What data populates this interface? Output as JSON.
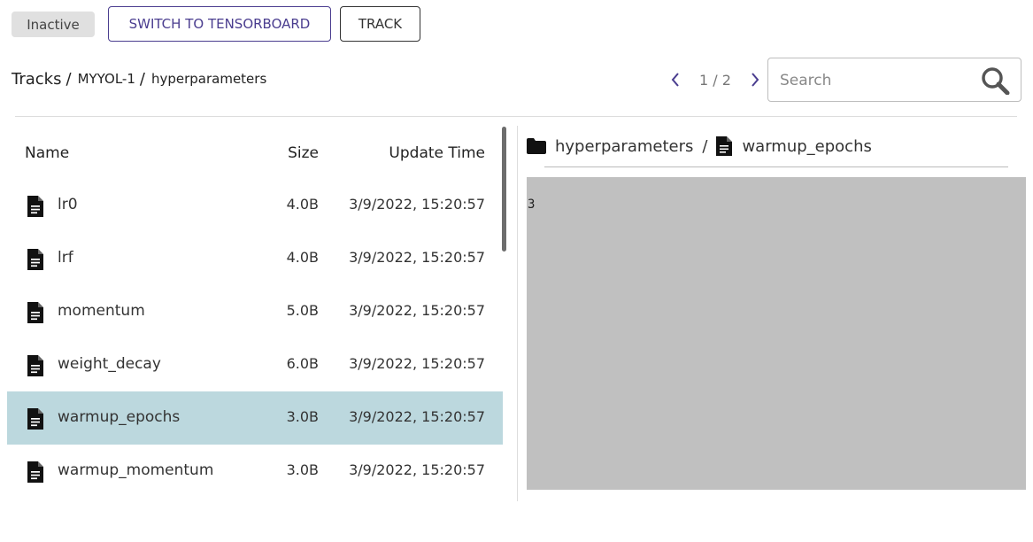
{
  "status": {
    "label": "Inactive"
  },
  "toolbar": {
    "tensorboard_label": "SWITCH TO TENSORBOARD",
    "track_label": "TRACK"
  },
  "breadcrumb": {
    "root": "Tracks",
    "separator": "/",
    "items": [
      "MYYOL-1",
      "hyperparameters"
    ]
  },
  "pagination": {
    "indicator": "1 / 2",
    "prev_icon": "chevron-left-icon",
    "next_icon": "chevron-right-icon"
  },
  "search": {
    "placeholder": "Search",
    "value": "",
    "icon": "search-icon"
  },
  "table": {
    "headers": {
      "name": "Name",
      "size": "Size",
      "update_time": "Update Time"
    },
    "rows": [
      {
        "name": "lr0",
        "size": "4.0B",
        "update_time": "3/9/2022, 15:20:57",
        "selected": false
      },
      {
        "name": "lrf",
        "size": "4.0B",
        "update_time": "3/9/2022, 15:20:57",
        "selected": false
      },
      {
        "name": "momentum",
        "size": "5.0B",
        "update_time": "3/9/2022, 15:20:57",
        "selected": false
      },
      {
        "name": "weight_decay",
        "size": "6.0B",
        "update_time": "3/9/2022, 15:20:57",
        "selected": false
      },
      {
        "name": "warmup_epochs",
        "size": "3.0B",
        "update_time": "3/9/2022, 15:20:57",
        "selected": true
      },
      {
        "name": "warmup_momentum",
        "size": "3.0B",
        "update_time": "3/9/2022, 15:20:57",
        "selected": false
      }
    ]
  },
  "preview": {
    "folder": "hyperparameters",
    "separator": "/",
    "file": "warmup_epochs",
    "content": "3"
  },
  "colors": {
    "accent": "#4a3d8f",
    "selected_row": "#bcd8de",
    "preview_bg": "#c0c0c0",
    "badge_bg": "#e0e0e0"
  }
}
